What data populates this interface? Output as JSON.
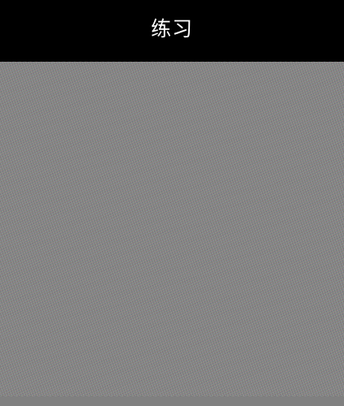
{
  "header": {
    "title": "练习"
  },
  "colors": {
    "header_background": "#000000",
    "title_text": "#ffffff",
    "canvas_background": "#858585"
  }
}
